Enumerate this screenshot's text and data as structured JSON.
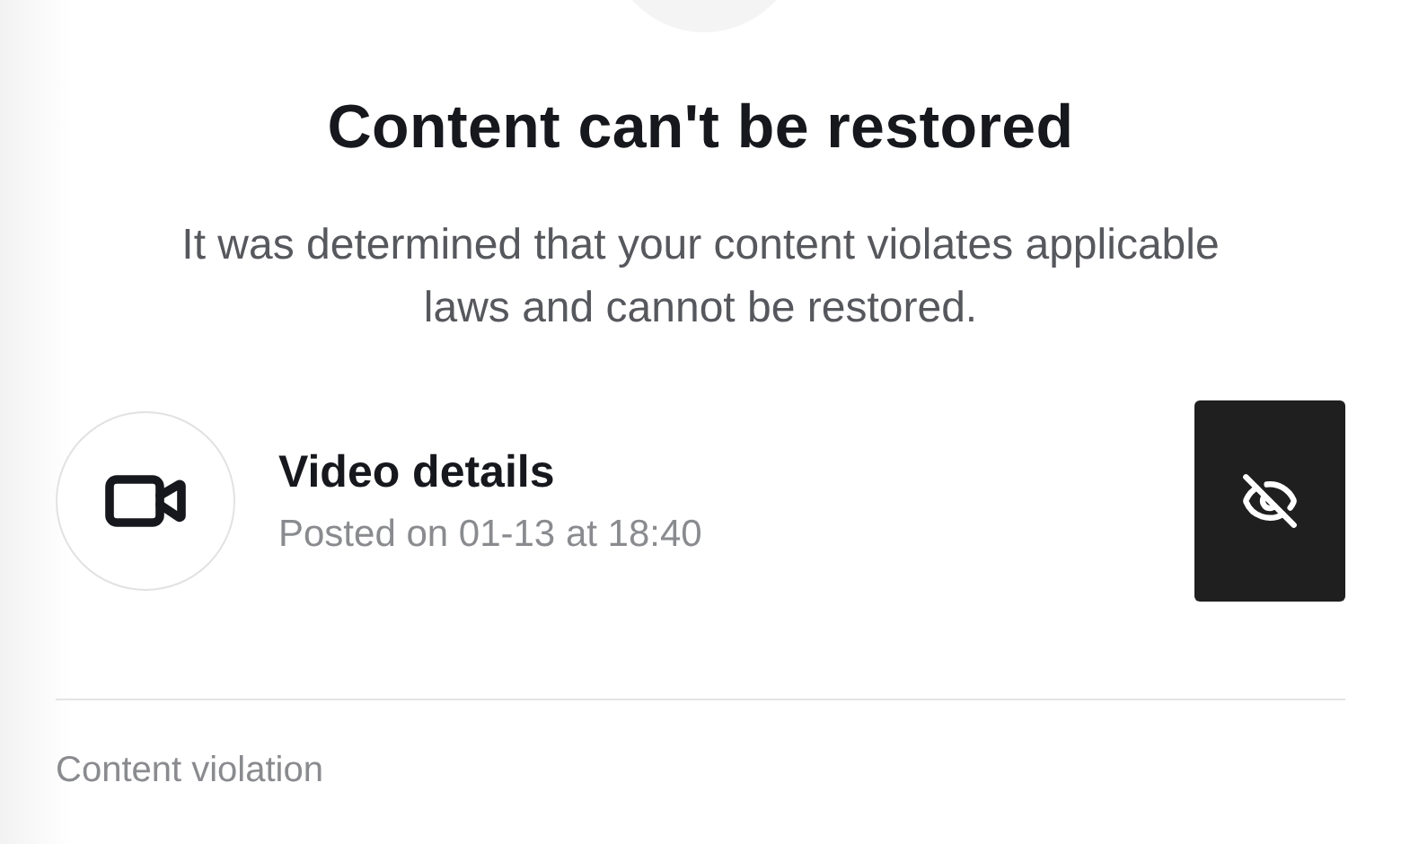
{
  "title": "Content can't be restored",
  "description": "It was determined that your content violates applicable laws and cannot be restored.",
  "video": {
    "title": "Video details",
    "posted": "Posted on 01-13 at 18:40",
    "hidden": true
  },
  "section_label": "Content violation"
}
